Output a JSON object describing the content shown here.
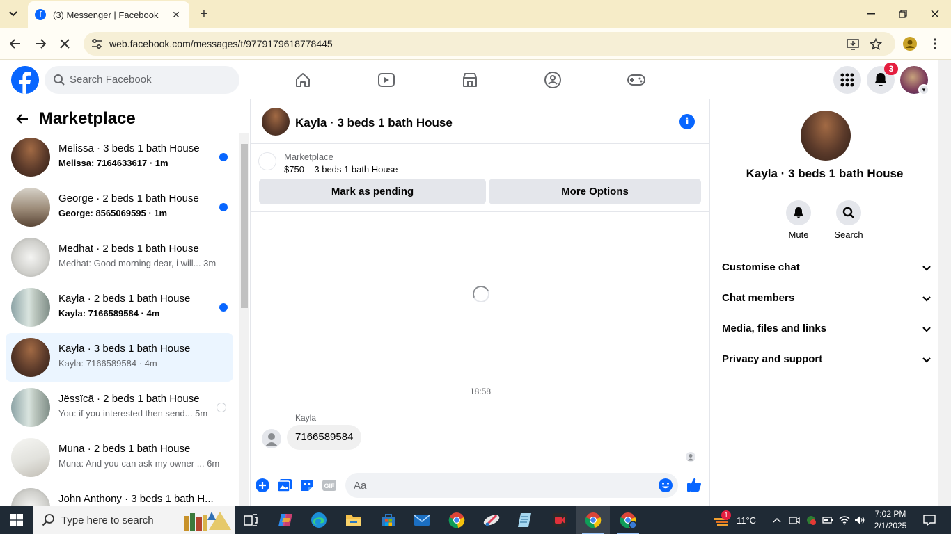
{
  "browser": {
    "tab_title": "(3) Messenger | Facebook",
    "url": "web.facebook.com/messages/t/9779179618778445"
  },
  "fbnav": {
    "search_placeholder": "Search Facebook",
    "notification_count": "3"
  },
  "left": {
    "title": "Marketplace",
    "conversations": [
      {
        "name": "Melissa · 3 beds 1 bath House",
        "sub": "Melissa: 7164633617 · 1m",
        "unread": true
      },
      {
        "name": "George · 2 beds 1 bath House",
        "sub": "George: 8565069595 · 1m",
        "unread": true
      },
      {
        "name": "Medhat · 2 beds 1 bath House",
        "sub": "Medhat: Good morning dear, i will...  3m",
        "unread": false
      },
      {
        "name": "Kayla · 2 beds 1 bath House",
        "sub": "Kayla: 7166589584 · 4m",
        "unread": true
      },
      {
        "name": "Kayla · 3 beds 1 bath House",
        "sub": "Kayla: 7166589584 · 4m",
        "unread": false
      },
      {
        "name": "Jëssïcä · 2 beds 1 bath House",
        "sub": "You: if you interested then send...  5m",
        "unread": false
      },
      {
        "name": "Muna · 2 beds 1 bath House",
        "sub": "Muna: And you can ask my owner ...  6m",
        "unread": false
      },
      {
        "name": "John Anthony · 3 beds 1 bath H...",
        "sub": "",
        "unread": false
      }
    ]
  },
  "chat": {
    "title": "Kayla · 3 beds 1 bath House",
    "marketplace_label": "Marketplace",
    "listing": "$750 – 3 beds 1 bath House",
    "btn_pending": "Mark as pending",
    "btn_more": "More Options",
    "timestamp": "18:58",
    "sender": "Kayla",
    "message": "7166589584",
    "composer_placeholder": "Aa"
  },
  "right": {
    "name": "Kayla · 3 beds 1 bath House",
    "mute_label": "Mute",
    "search_label": "Search",
    "sections": [
      "Customise chat",
      "Chat members",
      "Media, files and links",
      "Privacy and support"
    ]
  },
  "taskbar": {
    "search_placeholder": "Type here to search",
    "weather": "11°C",
    "weather_badge": "1",
    "time": "7:02 PM",
    "date": "2/1/2025"
  },
  "colors": {
    "accent": "#0866ff",
    "badge": "#e41e3f",
    "active_row": "#ebf5ff"
  }
}
